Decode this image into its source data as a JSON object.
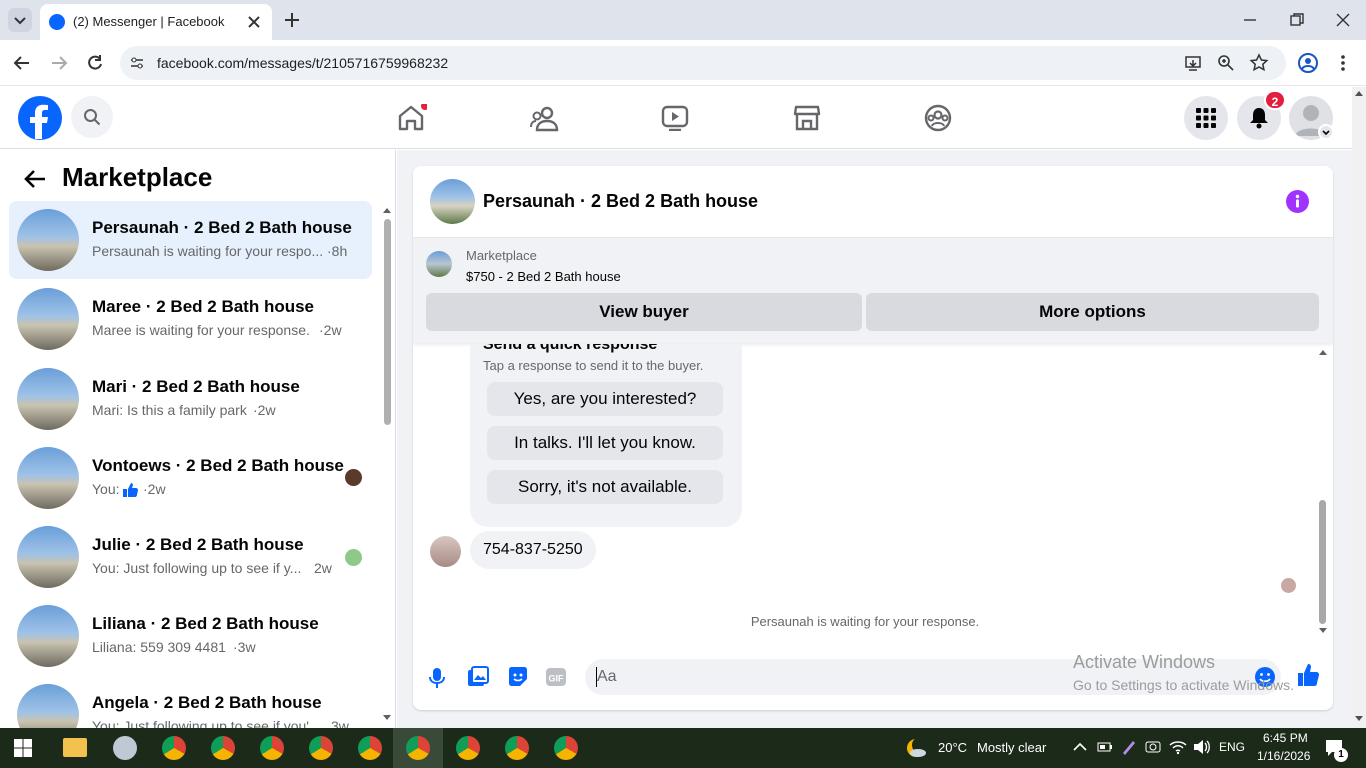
{
  "browser": {
    "tab_title": "(2) Messenger | Facebook",
    "url": "facebook.com/messages/t/2105716759968232"
  },
  "header": {
    "notification_count": "2"
  },
  "left_panel": {
    "title": "Marketplace",
    "conversations": [
      {
        "title": "Persaunah · 2 Bed 2 Bath house",
        "snippet": "Persaunah is waiting for your respo...",
        "time": "·8h",
        "selected": true
      },
      {
        "title": "Maree · 2 Bed 2 Bath house",
        "snippet": "Maree is waiting for your response.",
        "time": "·2w"
      },
      {
        "title": "Mari · 2 Bed 2 Bath house",
        "snippet": "Mari: Is this a family park",
        "time": "·2w"
      },
      {
        "title": "Vontoews · 2 Bed 2 Bath house",
        "snippet": "You:",
        "time": "·2w"
      },
      {
        "title": "Julie · 2 Bed 2 Bath house",
        "snippet": "You: Just following up to see if y...",
        "time": "2w"
      },
      {
        "title": "Liliana · 2 Bed 2 Bath house",
        "snippet": "Liliana: 559 309 4481",
        "time": "·3w"
      },
      {
        "title": "Angela · 2 Bed 2 Bath house",
        "snippet": "You: Just following up to see if you'...",
        "time": "3w"
      }
    ]
  },
  "chat": {
    "title": "Persaunah · 2 Bed 2 Bath house",
    "listing": {
      "source": "Marketplace",
      "summary": "$750 - 2 Bed 2 Bath house"
    },
    "view_buyer_label": "View buyer",
    "more_options_label": "More options",
    "quick_response": {
      "heading": "Send a quick response",
      "subtext": "Tap a response to send it to the buyer.",
      "options": [
        "Yes, are you interested?",
        "In talks. I'll let you know.",
        "Sorry, it's not available."
      ]
    },
    "message": "754-837-5250",
    "status": "Persaunah is waiting for your response.",
    "composer_placeholder": "Aa"
  },
  "watermark": {
    "line1": "Activate Windows",
    "line2": "Go to Settings to activate Windows."
  },
  "taskbar": {
    "weather_temp": "20°C",
    "weather_desc": "Mostly clear",
    "language": "ENG",
    "time": "6:45 PM",
    "date": "1/16/2026",
    "notification_badge": "1"
  },
  "colors": {
    "fb_blue": "#0866ff",
    "selected_bg": "#e7f0fd",
    "badge_red": "#e41e3f",
    "info_purple": "#a033ff"
  }
}
